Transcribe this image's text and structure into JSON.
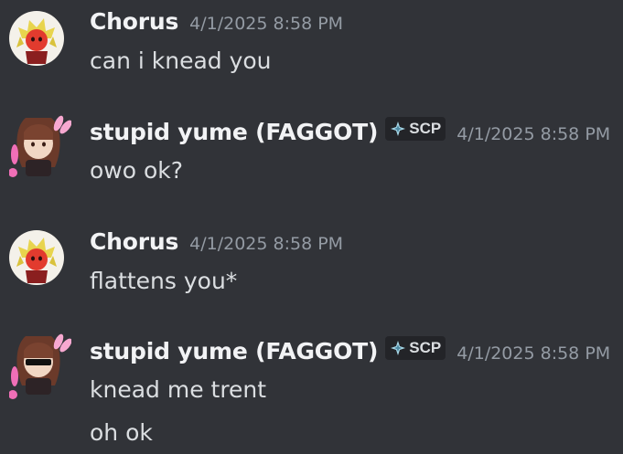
{
  "messages": [
    {
      "author": "Chorus",
      "timestamp": "4/1/2025 8:58 PM",
      "lines": [
        "can i knead you"
      ],
      "avatar_icon": "chorus-avatar"
    },
    {
      "author": "stupid yume (FAGGOT)",
      "tag": "SCP",
      "tag_icon": "diamond-sparkle-icon",
      "timestamp": "4/1/2025 8:58 PM",
      "lines": [
        "owo ok?"
      ],
      "avatar_icon": "yume-avatar"
    },
    {
      "author": "Chorus",
      "timestamp": "4/1/2025 8:58 PM",
      "lines": [
        "flattens you*"
      ],
      "avatar_icon": "chorus-avatar"
    },
    {
      "author": "stupid yume (FAGGOT)",
      "tag": "SCP",
      "tag_icon": "diamond-sparkle-icon",
      "timestamp": "4/1/2025 8:58 PM",
      "lines": [
        "knead me trent",
        "oh ok"
      ],
      "avatar_icon": "yume-avatar-sunglasses"
    }
  ],
  "colors": {
    "background": "#313338",
    "username": "#f2f3f5",
    "text": "#dbdee1",
    "timestamp": "#949ba4",
    "tag_background": "#232428"
  }
}
